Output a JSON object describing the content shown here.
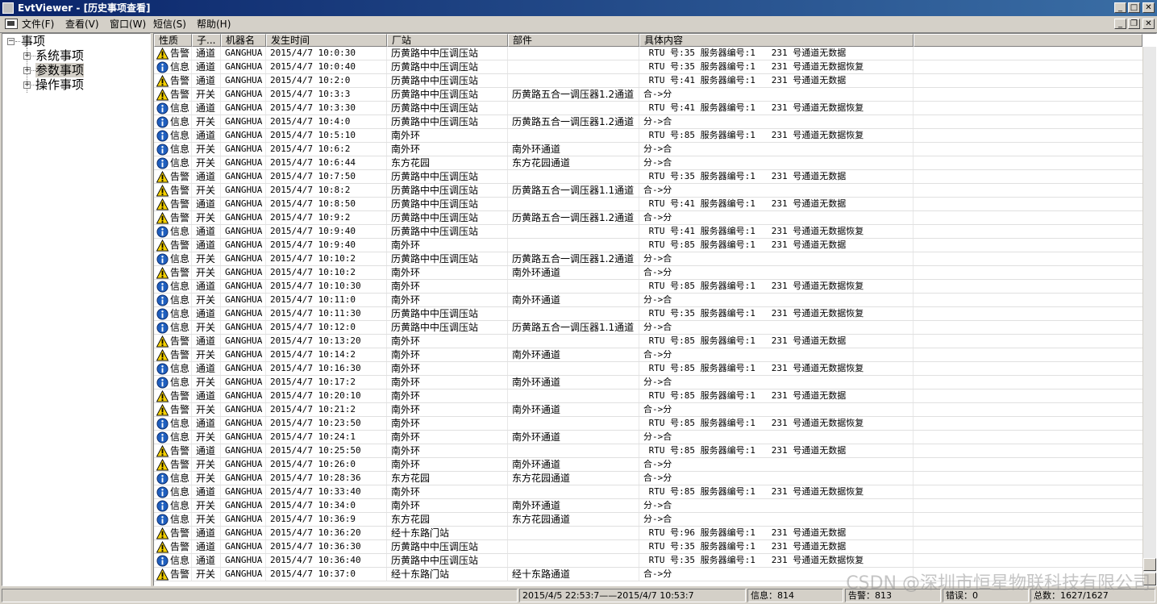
{
  "window": {
    "title": "EvtViewer - [历史事项查看]"
  },
  "menu": {
    "items": [
      "文件(F)",
      "查看(V)",
      "窗口(W)",
      "短信(S)",
      "帮助(H)"
    ]
  },
  "tree": {
    "root": "事项",
    "children": [
      "系统事项",
      "参数事项",
      "操作事项"
    ],
    "selected": "参数事项"
  },
  "grid": {
    "columns": [
      "性质",
      "子...",
      "机器名",
      "发生时间",
      "厂站",
      "部件",
      "具体内容"
    ],
    "rows": [
      [
        "告警",
        "通道",
        "GANGHUA",
        "2015/4/7 10:0:30",
        "历黄路中中压调压站",
        "",
        " RTU 号:35 服务器编号:1   231 号通道无数据"
      ],
      [
        "信息",
        "通道",
        "GANGHUA",
        "2015/4/7 10:0:40",
        "历黄路中中压调压站",
        "",
        " RTU 号:35 服务器编号:1   231 号通道无数据恢复"
      ],
      [
        "告警",
        "通道",
        "GANGHUA",
        "2015/4/7 10:2:0",
        "历黄路中中压调压站",
        "",
        " RTU 号:41 服务器编号:1   231 号通道无数据"
      ],
      [
        "告警",
        "开关",
        "GANGHUA",
        "2015/4/7 10:3:3",
        "历黄路中中压调压站",
        "历黄路五合一调压器1.2通道",
        "合->分"
      ],
      [
        "信息",
        "通道",
        "GANGHUA",
        "2015/4/7 10:3:30",
        "历黄路中中压调压站",
        "",
        " RTU 号:41 服务器编号:1   231 号通道无数据恢复"
      ],
      [
        "信息",
        "开关",
        "GANGHUA",
        "2015/4/7 10:4:0",
        "历黄路中中压调压站",
        "历黄路五合一调压器1.2通道",
        "分->合"
      ],
      [
        "信息",
        "通道",
        "GANGHUA",
        "2015/4/7 10:5:10",
        "南外环",
        "",
        " RTU 号:85 服务器编号:1   231 号通道无数据恢复"
      ],
      [
        "信息",
        "开关",
        "GANGHUA",
        "2015/4/7 10:6:2",
        "南外环",
        "南外环通道",
        "分->合"
      ],
      [
        "信息",
        "开关",
        "GANGHUA",
        "2015/4/7 10:6:44",
        "东方花园",
        "东方花园通道",
        "分->合"
      ],
      [
        "告警",
        "通道",
        "GANGHUA",
        "2015/4/7 10:7:50",
        "历黄路中中压调压站",
        "",
        " RTU 号:35 服务器编号:1   231 号通道无数据"
      ],
      [
        "告警",
        "开关",
        "GANGHUA",
        "2015/4/7 10:8:2",
        "历黄路中中压调压站",
        "历黄路五合一调压器1.1通道",
        "合->分"
      ],
      [
        "告警",
        "通道",
        "GANGHUA",
        "2015/4/7 10:8:50",
        "历黄路中中压调压站",
        "",
        " RTU 号:41 服务器编号:1   231 号通道无数据"
      ],
      [
        "告警",
        "开关",
        "GANGHUA",
        "2015/4/7 10:9:2",
        "历黄路中中压调压站",
        "历黄路五合一调压器1.2通道",
        "合->分"
      ],
      [
        "信息",
        "通道",
        "GANGHUA",
        "2015/4/7 10:9:40",
        "历黄路中中压调压站",
        "",
        " RTU 号:41 服务器编号:1   231 号通道无数据恢复"
      ],
      [
        "告警",
        "通道",
        "GANGHUA",
        "2015/4/7 10:9:40",
        "南外环",
        "",
        " RTU 号:85 服务器编号:1   231 号通道无数据"
      ],
      [
        "信息",
        "开关",
        "GANGHUA",
        "2015/4/7 10:10:2",
        "历黄路中中压调压站",
        "历黄路五合一调压器1.2通道",
        "分->合"
      ],
      [
        "告警",
        "开关",
        "GANGHUA",
        "2015/4/7 10:10:2",
        "南外环",
        "南外环通道",
        "合->分"
      ],
      [
        "信息",
        "通道",
        "GANGHUA",
        "2015/4/7 10:10:30",
        "南外环",
        "",
        " RTU 号:85 服务器编号:1   231 号通道无数据恢复"
      ],
      [
        "信息",
        "开关",
        "GANGHUA",
        "2015/4/7 10:11:0",
        "南外环",
        "南外环通道",
        "分->合"
      ],
      [
        "信息",
        "通道",
        "GANGHUA",
        "2015/4/7 10:11:30",
        "历黄路中中压调压站",
        "",
        " RTU 号:35 服务器编号:1   231 号通道无数据恢复"
      ],
      [
        "信息",
        "开关",
        "GANGHUA",
        "2015/4/7 10:12:0",
        "历黄路中中压调压站",
        "历黄路五合一调压器1.1通道",
        "分->合"
      ],
      [
        "告警",
        "通道",
        "GANGHUA",
        "2015/4/7 10:13:20",
        "南外环",
        "",
        " RTU 号:85 服务器编号:1   231 号通道无数据"
      ],
      [
        "告警",
        "开关",
        "GANGHUA",
        "2015/4/7 10:14:2",
        "南外环",
        "南外环通道",
        "合->分"
      ],
      [
        "信息",
        "通道",
        "GANGHUA",
        "2015/4/7 10:16:30",
        "南外环",
        "",
        " RTU 号:85 服务器编号:1   231 号通道无数据恢复"
      ],
      [
        "信息",
        "开关",
        "GANGHUA",
        "2015/4/7 10:17:2",
        "南外环",
        "南外环通道",
        "分->合"
      ],
      [
        "告警",
        "通道",
        "GANGHUA",
        "2015/4/7 10:20:10",
        "南外环",
        "",
        " RTU 号:85 服务器编号:1   231 号通道无数据"
      ],
      [
        "告警",
        "开关",
        "GANGHUA",
        "2015/4/7 10:21:2",
        "南外环",
        "南外环通道",
        "合->分"
      ],
      [
        "信息",
        "通道",
        "GANGHUA",
        "2015/4/7 10:23:50",
        "南外环",
        "",
        " RTU 号:85 服务器编号:1   231 号通道无数据恢复"
      ],
      [
        "信息",
        "开关",
        "GANGHUA",
        "2015/4/7 10:24:1",
        "南外环",
        "南外环通道",
        "分->合"
      ],
      [
        "告警",
        "通道",
        "GANGHUA",
        "2015/4/7 10:25:50",
        "南外环",
        "",
        " RTU 号:85 服务器编号:1   231 号通道无数据"
      ],
      [
        "告警",
        "开关",
        "GANGHUA",
        "2015/4/7 10:26:0",
        "南外环",
        "南外环通道",
        "合->分"
      ],
      [
        "信息",
        "开关",
        "GANGHUA",
        "2015/4/7 10:28:36",
        "东方花园",
        "东方花园通道",
        "合->分"
      ],
      [
        "信息",
        "通道",
        "GANGHUA",
        "2015/4/7 10:33:40",
        "南外环",
        "",
        " RTU 号:85 服务器编号:1   231 号通道无数据恢复"
      ],
      [
        "信息",
        "开关",
        "GANGHUA",
        "2015/4/7 10:34:0",
        "南外环",
        "南外环通道",
        "分->合"
      ],
      [
        "信息",
        "开关",
        "GANGHUA",
        "2015/4/7 10:36:9",
        "东方花园",
        "东方花园通道",
        "分->合"
      ],
      [
        "告警",
        "通道",
        "GANGHUA",
        "2015/4/7 10:36:20",
        "经十东路门站",
        "",
        " RTU 号:96 服务器编号:1   231 号通道无数据"
      ],
      [
        "告警",
        "通道",
        "GANGHUA",
        "2015/4/7 10:36:30",
        "历黄路中中压调压站",
        "",
        " RTU 号:35 服务器编号:1   231 号通道无数据"
      ],
      [
        "信息",
        "通道",
        "GANGHUA",
        "2015/4/7 10:36:40",
        "历黄路中中压调压站",
        "",
        " RTU 号:35 服务器编号:1   231 号通道无数据恢复"
      ],
      [
        "告警",
        "开关",
        "GANGHUA",
        "2015/4/7 10:37:0",
        "经十东路门站",
        "经十东路通道",
        "合->分"
      ]
    ]
  },
  "status": {
    "range": "2015/4/5 22:53:7——2015/4/7 10:53:7",
    "info": "信息：814",
    "alarm": "告警：813",
    "error": "错误：0",
    "total": "总数：1627/1627"
  },
  "watermark": "CSDN @深圳市恒星物联科技有限公司",
  "colors": {
    "title_start": "#0a246a",
    "title_end": "#3a6ea5",
    "warn": "#f5d000",
    "info": "#1f5fbf"
  },
  "icons": {
    "alarm": "warning-icon",
    "info": "info-icon"
  }
}
